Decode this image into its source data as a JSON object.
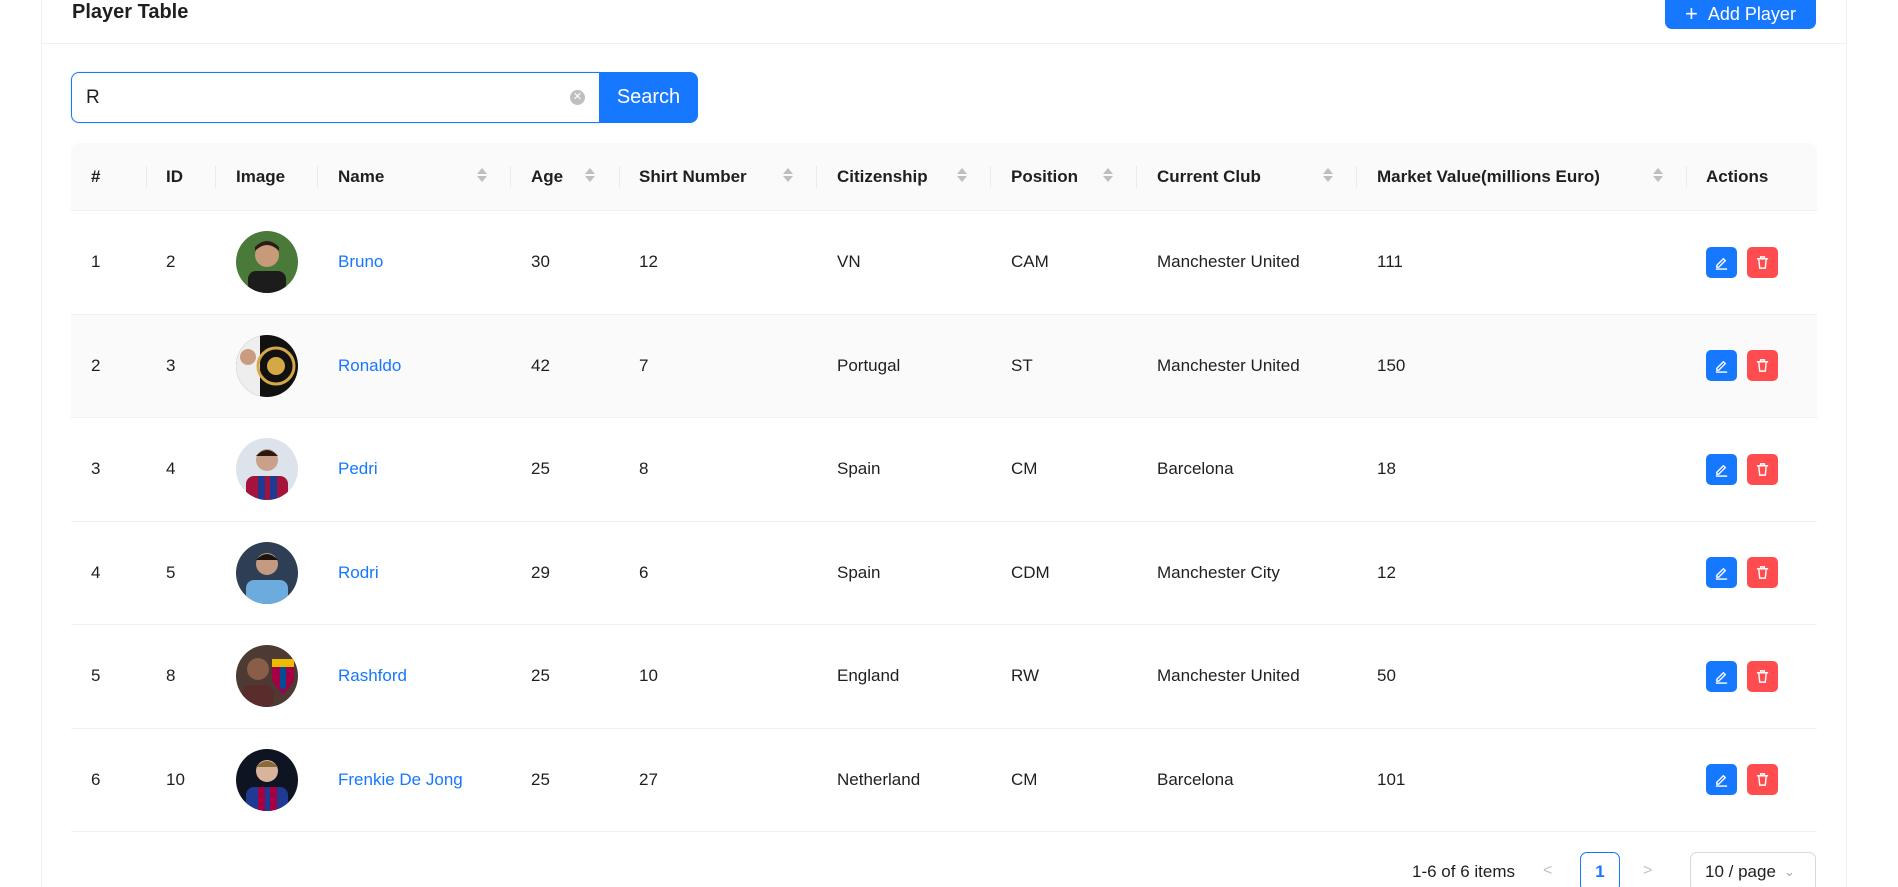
{
  "header": {
    "title": "Player Table",
    "add_button_label": "Add Player"
  },
  "search": {
    "value": "R",
    "button_label": "Search"
  },
  "table": {
    "columns": [
      "#",
      "ID",
      "Image",
      "Name",
      "Age",
      "Shirt Number",
      "Citizenship",
      "Position",
      "Current Club",
      "Market Value(millions Euro)",
      "Actions"
    ],
    "rows": [
      {
        "index": "1",
        "id": "2",
        "name": "Bruno",
        "age": "30",
        "shirt": "12",
        "citizenship": "VN",
        "position": "CAM",
        "club": "Manchester United",
        "value": "111"
      },
      {
        "index": "2",
        "id": "3",
        "name": "Ronaldo",
        "age": "42",
        "shirt": "7",
        "citizenship": "Portugal",
        "position": "ST",
        "club": "Manchester United",
        "value": "150"
      },
      {
        "index": "3",
        "id": "4",
        "name": "Pedri",
        "age": "25",
        "shirt": "8",
        "citizenship": "Spain",
        "position": "CM",
        "club": "Barcelona",
        "value": "18"
      },
      {
        "index": "4",
        "id": "5",
        "name": "Rodri",
        "age": "29",
        "shirt": "6",
        "citizenship": "Spain",
        "position": "CDM",
        "club": "Manchester City",
        "value": "12"
      },
      {
        "index": "5",
        "id": "8",
        "name": "Rashford",
        "age": "25",
        "shirt": "10",
        "citizenship": "England",
        "position": "RW",
        "club": "Manchester United",
        "value": "50"
      },
      {
        "index": "6",
        "id": "10",
        "name": "Frenkie De Jong",
        "age": "25",
        "shirt": "27",
        "citizenship": "Netherland",
        "position": "CM",
        "club": "Barcelona",
        "value": "101"
      }
    ]
  },
  "pagination": {
    "total_text": "1-6 of 6 items",
    "current_page": "1",
    "page_size": "10 / page"
  },
  "colors": {
    "primary": "#1677ff",
    "danger": "#ff4d4f",
    "link": "#1677ff"
  }
}
